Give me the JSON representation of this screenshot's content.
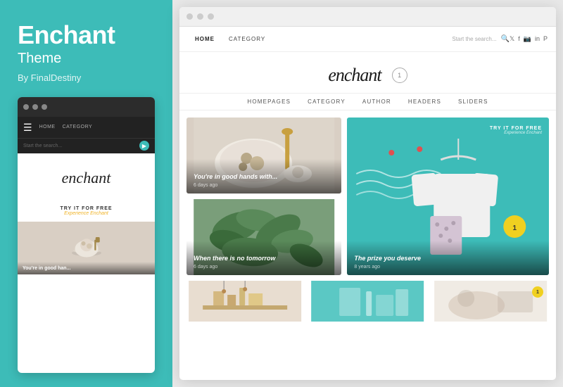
{
  "left": {
    "title": "Enchant",
    "subtitle": "Theme",
    "author": "By FinalDestiny",
    "mini_nav": {
      "items": [
        "HOME",
        "CATEGORY"
      ]
    },
    "mini_search_placeholder": "Start the search...",
    "mini_logo": "enchant",
    "mini_cta": "TRY IT FOR FREE",
    "mini_cta_sub": "Experience Enchant",
    "mini_article_title": "You're in good han..."
  },
  "browser": {
    "nav": {
      "items": [
        "HOME",
        "CATEGORY"
      ],
      "search_placeholder": "Start the search...",
      "social_icons": [
        "twitter",
        "facebook",
        "instagram",
        "linkedin",
        "pinterest"
      ]
    },
    "logo": "enchant",
    "logo_badge": "1",
    "secondary_nav": {
      "items": [
        "HOMEPAGES",
        "CATEGORY",
        "AUTHOR",
        "HEADERS",
        "SLIDERS"
      ]
    },
    "articles": [
      {
        "title": "You're in good hands with...",
        "meta": "6 days ago",
        "bg": "food"
      },
      {
        "title": "When there is no tomorrow",
        "meta": "6 days ago",
        "bg": "plant"
      },
      {
        "title": "The prize you deserve",
        "meta": "8 years ago",
        "bg": "teal",
        "cta": "TRY IT FOR FREE",
        "cta_sub": "Experience Enchant",
        "badge": "1"
      }
    ],
    "bottom_articles": [
      {
        "bg": "beige",
        "badge": null
      },
      {
        "bg": "teal2",
        "badge": null
      },
      {
        "bg": "beige2",
        "badge": "1"
      }
    ]
  },
  "colors": {
    "accent": "#3dbcb8",
    "yellow": "#f0d020",
    "dark": "#222222",
    "text_muted": "#888888"
  }
}
